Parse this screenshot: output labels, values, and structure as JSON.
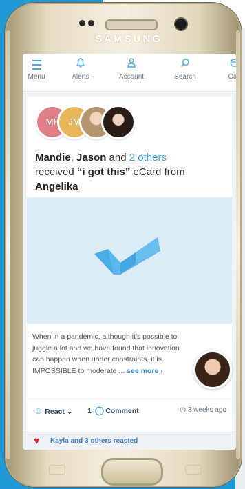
{
  "device": {
    "brand": "SAMSUNG"
  },
  "nav": {
    "items": [
      {
        "label": "Menu",
        "icon": "hamburger-icon"
      },
      {
        "label": "Alerts",
        "icon": "bell-icon"
      },
      {
        "label": "Account",
        "icon": "user-icon"
      },
      {
        "label": "Search",
        "icon": "search-icon"
      },
      {
        "label": "Cart",
        "icon": "cart-icon"
      }
    ]
  },
  "post": {
    "avatars": [
      {
        "initials": "MF",
        "color": "#e17f86"
      },
      {
        "initials": "JM",
        "color": "#e8b559"
      },
      {
        "initials": "",
        "icon": "photo-avatar"
      },
      {
        "initials": "",
        "icon": "photo-avatar"
      }
    ],
    "headline": {
      "name1": "Mandie",
      "sep1": ", ",
      "name2": "Jason",
      "and": " and ",
      "others": "2 others",
      "received": "received ",
      "ecard_name": "“i got this”",
      "ecard_from": " eCard from",
      "sender": "Angelika"
    },
    "body": "When in a pandemic, although it's possible to juggle a lot and we have found that innovation can happen when under constraints, it is IMPOSSIBLE to moderate ... ",
    "see_more": "see more ›",
    "actions": {
      "react_label": "React",
      "comment_count": "1",
      "comment_label": "Comment",
      "time": "3 weeks ago"
    },
    "reactions_text": "Kayla and 3 others reacted"
  },
  "colors": {
    "accent": "#3aa0df",
    "background": "#1f9ad6",
    "heart": "#d7262f",
    "ecard_bg": "#dcecf7",
    "check": "#4aaee6"
  }
}
